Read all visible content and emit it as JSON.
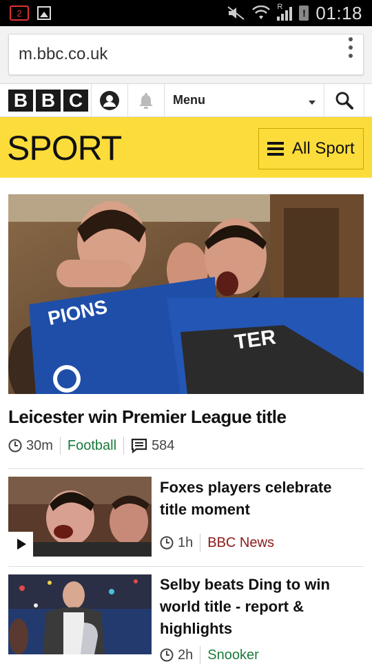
{
  "statusbar": {
    "notification_badge": "2",
    "time": "01:18",
    "icons": [
      "notification-badge-icon",
      "gallery-icon",
      "mute-icon",
      "wifi-icon",
      "roaming-signal-icon",
      "battery-alert-icon"
    ],
    "roaming_label": "R",
    "battery_alert": "!"
  },
  "browser": {
    "url": "m.bbc.co.uk",
    "menu_icon": "overflow-menu-icon"
  },
  "masthead": {
    "logo_letters": [
      "B",
      "B",
      "C"
    ],
    "menu_label": "Menu",
    "icons": [
      "account-icon",
      "notification-bell-icon",
      "chevron-down-icon",
      "search-icon"
    ]
  },
  "sport_header": {
    "title": "SPORT",
    "all_sport_label": "All Sport",
    "accent_color": "#fcdc3b"
  },
  "hero": {
    "title": "Leicester win Premier League title",
    "time": "30m",
    "section": "Football",
    "comments": "584",
    "image_text": [
      "PIONS",
      "TER"
    ]
  },
  "stories": [
    {
      "title": "Foxes players celebrate title moment",
      "time": "1h",
      "source": "BBC News",
      "has_video": true
    },
    {
      "title": "Selby beats Ding to win world title - report & highlights",
      "time": "2h",
      "source": "Snooker",
      "has_video": false
    }
  ],
  "colors": {
    "section_green": "#1a7a3a",
    "bbc_news_red": "#8a1a1a",
    "logo_black": "#1a1a1a"
  }
}
